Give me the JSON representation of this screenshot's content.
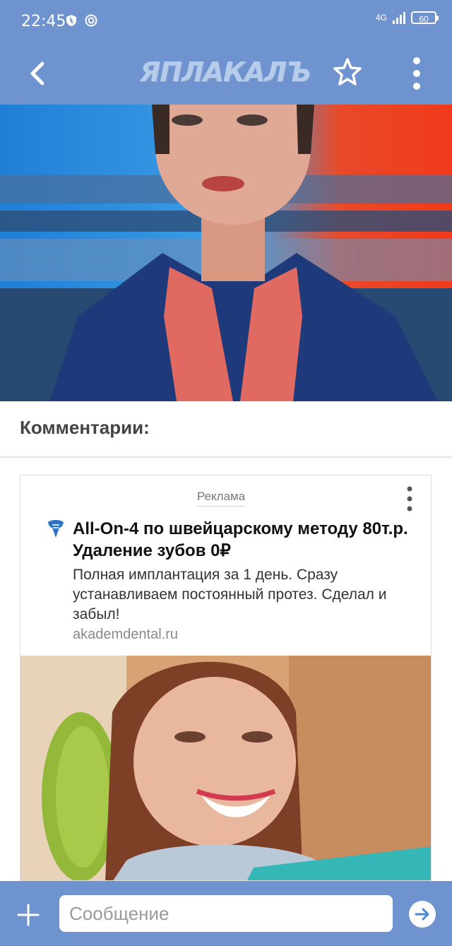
{
  "status_bar": {
    "time": "22:45",
    "network": "4G",
    "battery": "60",
    "icons": [
      "shield-icon",
      "settings-circle-icon",
      "signal-icon",
      "battery-icon"
    ]
  },
  "app_bar": {
    "logo_text": "ЯПЛАКАЛЪ",
    "icons": [
      "back-arrow-icon",
      "star-icon",
      "more-vertical-icon"
    ]
  },
  "post": {
    "image_alt": "news anchor"
  },
  "comments": {
    "title": "Комментарии:"
  },
  "ad": {
    "label": "Реклама",
    "title": "All-On-4 по швейцарскому методу 80т.р. Удаление зубов 0₽",
    "description": "Полная имплантация за 1 день. Сразу устанавливаем постоянный протез. Сделал и забыл!",
    "domain": "akademdental.ru",
    "icons": [
      "tooth-logo-icon",
      "more-vertical-icon"
    ]
  },
  "composer": {
    "placeholder": "Сообщение",
    "icons": [
      "plus-icon",
      "send-icon"
    ]
  },
  "colors": {
    "bar": "#6f93cf",
    "logo": "#b7cbea",
    "text_dark": "#111111",
    "text_muted": "#8a8a8a"
  }
}
